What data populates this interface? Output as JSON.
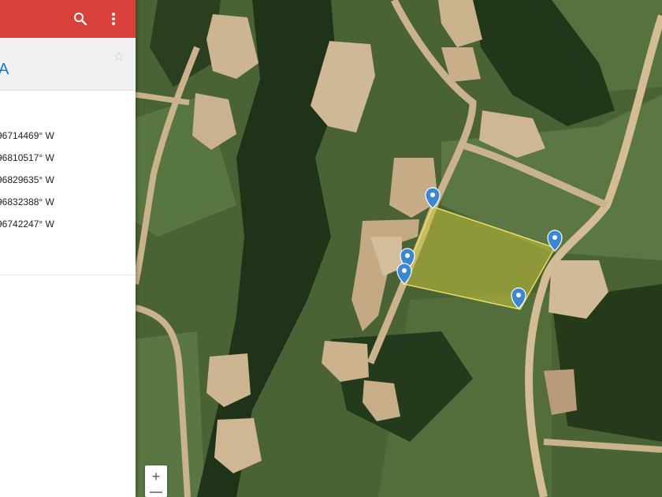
{
  "toolbar": {
    "search_icon": "search-icon",
    "more_icon": "more-vert-icon",
    "color": "#d9403a"
  },
  "project": {
    "title_fragment": "A",
    "star_icon": "star-outline-icon"
  },
  "coordinates": [
    "96714469° W",
    "96810517° W",
    "96829635° W",
    "96832388° W",
    "96742247° W"
  ],
  "map": {
    "type": "satellite",
    "polygon_fill": "#c8c43a",
    "marker_color": "#3b87d6",
    "marker_count": 5,
    "zoom_in_label": "+"
  }
}
